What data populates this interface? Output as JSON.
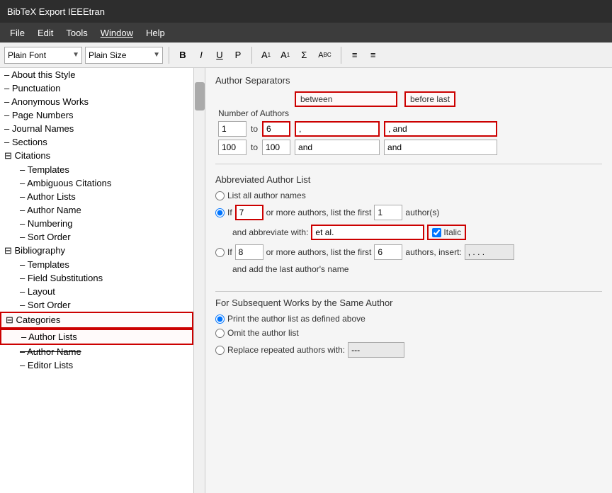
{
  "titleBar": {
    "text": "BibTeX Export IEEEtran"
  },
  "menuBar": {
    "items": [
      {
        "label": "File",
        "underline": false
      },
      {
        "label": "Edit",
        "underline": false
      },
      {
        "label": "Tools",
        "underline": false
      },
      {
        "label": "Window",
        "underline": true
      },
      {
        "label": "Help",
        "underline": false
      }
    ]
  },
  "toolbar": {
    "fontSelect": "Plain Font",
    "sizeSelect": "Plain Size",
    "buttons": [
      "B",
      "I",
      "U",
      "P",
      "A¹",
      "A₁",
      "Σ",
      "Abc",
      "≡",
      "≡"
    ]
  },
  "sidebar": {
    "items": [
      {
        "label": "About this Style",
        "level": 0,
        "type": "dash"
      },
      {
        "label": "Punctuation",
        "level": 0,
        "type": "dash"
      },
      {
        "label": "Anonymous Works",
        "level": 0,
        "type": "dash"
      },
      {
        "label": "Page Numbers",
        "level": 0,
        "type": "dash"
      },
      {
        "label": "Journal Names",
        "level": 0,
        "type": "dash"
      },
      {
        "label": "Sections",
        "level": 0,
        "type": "dash"
      },
      {
        "label": "Citations",
        "level": 0,
        "type": "tri-open"
      },
      {
        "label": "Templates",
        "level": 1,
        "type": "dash"
      },
      {
        "label": "Ambiguous Citations",
        "level": 1,
        "type": "dash"
      },
      {
        "label": "Author Lists",
        "level": 1,
        "type": "dash"
      },
      {
        "label": "Author Name",
        "level": 1,
        "type": "dash"
      },
      {
        "label": "Numbering",
        "level": 1,
        "type": "dash"
      },
      {
        "label": "Sort Order",
        "level": 1,
        "type": "dash"
      },
      {
        "label": "Bibliography",
        "level": 0,
        "type": "tri-open"
      },
      {
        "label": "Templates",
        "level": 1,
        "type": "dash"
      },
      {
        "label": "Field Substitutions",
        "level": 1,
        "type": "dash"
      },
      {
        "label": "Layout",
        "level": 1,
        "type": "dash"
      },
      {
        "label": "Sort Order",
        "level": 1,
        "type": "dash"
      },
      {
        "label": "Categories",
        "level": 0,
        "type": "tri-open",
        "highlighted": true
      },
      {
        "label": "Author Lists",
        "level": 1,
        "type": "dash",
        "highlighted": true
      },
      {
        "label": "Author Name",
        "level": 1,
        "type": "dash",
        "strikethrough": true
      },
      {
        "label": "Editor Lists",
        "level": 1,
        "type": "dash"
      }
    ]
  },
  "content": {
    "authorSeparators": {
      "title": "Author Separators",
      "col_number": "Number of Authors",
      "col_between": "between",
      "col_beforeLast": "before last",
      "rows": [
        {
          "from": "1",
          "to": "6",
          "between": ",",
          "beforeLast": ", and",
          "highlightFrom": false,
          "highlightTo": true,
          "highlightBetween": true,
          "highlightBeforeLast": true
        },
        {
          "from": "100",
          "to": "100",
          "between": "and",
          "beforeLast": "and",
          "highlightFrom": false,
          "highlightTo": false,
          "highlightBetween": false,
          "highlightBeforeLast": false
        }
      ]
    },
    "abbreviatedAuthorList": {
      "title": "Abbreviated Author List",
      "radio1": {
        "label": "List all author names"
      },
      "radio2": {
        "label": "If",
        "value1": "7",
        "middle": "or more authors, list the first",
        "value2": "1",
        "suffix": "author(s)"
      },
      "abbreviateWith": {
        "label": "and abbreviate with:",
        "value": "et al.",
        "italic": "Italic"
      },
      "radio3": {
        "label": "If",
        "value1": "8",
        "middle": "or more authors, list the first",
        "value2": "6",
        "suffix": "authors, insert:",
        "insertValue": ", . . ."
      },
      "addLastAuthor": "and add the last author's name"
    },
    "subsequentWorks": {
      "title": "For Subsequent Works by the Same Author",
      "radio1": "Print the author list as defined above",
      "radio2": "Omit the author list",
      "radio3": "Replace repeated authors with:",
      "radio3Value": "---"
    }
  }
}
